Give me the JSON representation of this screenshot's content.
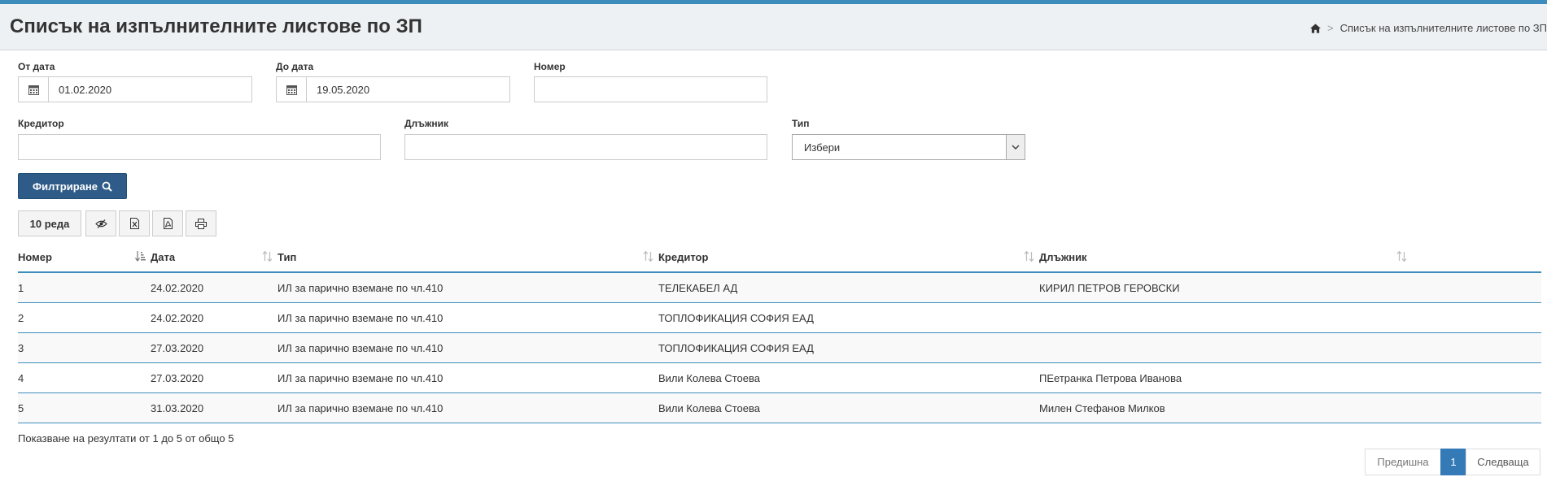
{
  "header": {
    "title": "Списък на изпълнителните листове по ЗП",
    "breadcrumb": "Списък на изпълнителните листове по ЗП"
  },
  "filters": {
    "from_label": "От дата",
    "from_value": "01.02.2020",
    "to_label": "До дата",
    "to_value": "19.05.2020",
    "number_label": "Номер",
    "number_value": "",
    "creditor_label": "Кредитор",
    "creditor_value": "",
    "debtor_label": "Длъжник",
    "debtor_value": "",
    "type_label": "Тип",
    "type_value": "Избери",
    "filter_button": "Филтриране"
  },
  "toolbar": {
    "rows_label": "10 реда",
    "icons": [
      "eye-slash-icon",
      "excel-icon",
      "pdf-icon",
      "print-icon"
    ]
  },
  "table": {
    "columns": [
      "Номер",
      "Дата",
      "Тип",
      "Кредитор",
      "Длъжник"
    ],
    "rows": [
      [
        "1",
        "24.02.2020",
        "ИЛ за парично вземане по чл.410",
        "ТЕЛЕКАБЕЛ АД",
        "КИРИЛ ПЕТРОВ ГЕРОВСКИ"
      ],
      [
        "2",
        "24.02.2020",
        "ИЛ за парично вземане по чл.410",
        "ТОПЛОФИКАЦИЯ СОФИЯ ЕАД",
        ""
      ],
      [
        "3",
        "27.03.2020",
        "ИЛ за парично вземане по чл.410",
        "ТОПЛОФИКАЦИЯ СОФИЯ ЕАД",
        ""
      ],
      [
        "4",
        "27.03.2020",
        "ИЛ за парично вземане по чл.410",
        "Вили Колева Стоева",
        "ПЕетранка Петрова Иванова"
      ],
      [
        "5",
        "31.03.2020",
        "ИЛ за парично вземане по чл.410",
        "Вили Колева Стоева",
        "Милен Стефанов Милков"
      ]
    ]
  },
  "footer": {
    "info": "Показване на резултати от 1 до 5 от общо 5",
    "prev": "Предишна",
    "current": "1",
    "next": "Следваща"
  },
  "colors": {
    "accent": "#3c8dbc",
    "button": "#2f5b88",
    "page_active": "#337ab7"
  }
}
